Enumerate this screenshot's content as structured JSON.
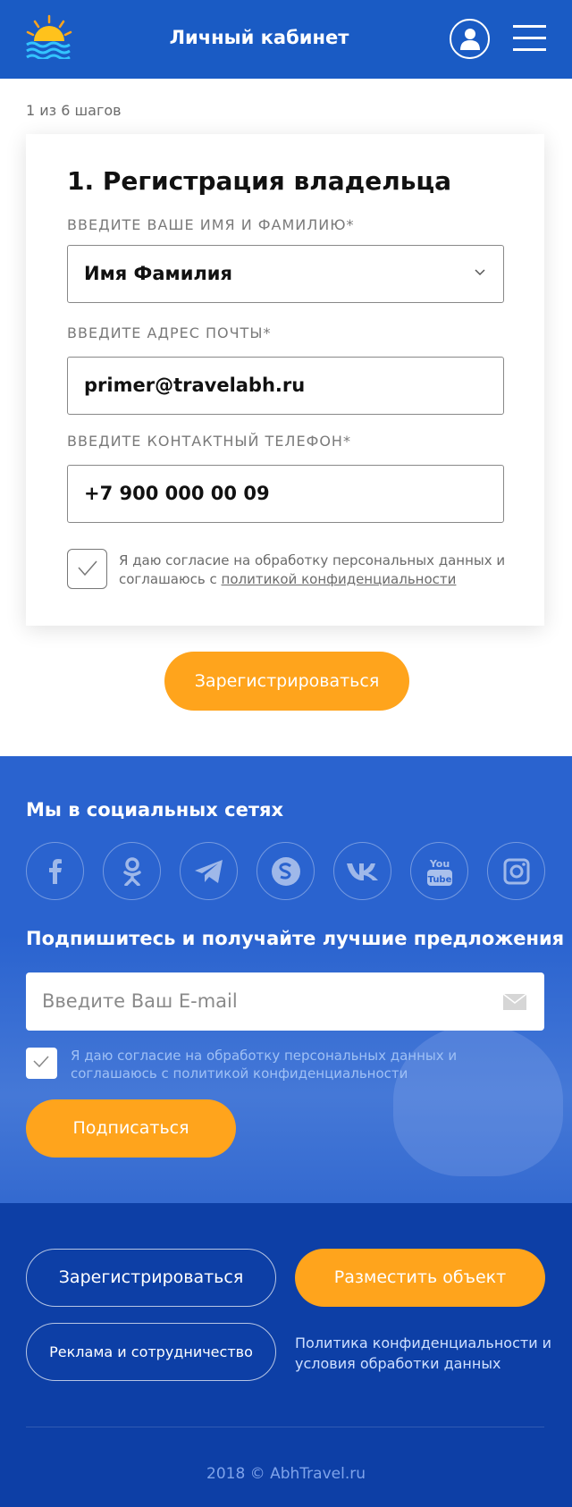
{
  "header": {
    "title": "Личный кабинет"
  },
  "step": "1 из 6 шагов",
  "form": {
    "title": "1. Регистрация владельца",
    "name_label": "ВВЕДИТЕ ВАШЕ ИМЯ И ФАМИЛИЮ*",
    "name_value": "Имя Фамилия",
    "email_label": "ВВЕДИТЕ АДРЕС ПОЧТЫ*",
    "email_value": "primer@travelabh.ru",
    "phone_label": "ВВЕДИТЕ КОНТАКТНЫЙ ТЕЛЕФОН*",
    "phone_value": "+7 900 000 00 09",
    "consent_text": "Я даю согласие на обработку персональных данных и соглашаюсь с",
    "consent_link": "политикой конфиденциальности",
    "consent_checked": true,
    "submit_label": "Зарегистрироваться"
  },
  "social": {
    "title": "Мы в социальных сетях",
    "icons": [
      "facebook-icon",
      "odnoklassniki-icon",
      "telegram-icon",
      "skype-icon",
      "vk-icon",
      "youtube-icon",
      "instagram-icon"
    ]
  },
  "subscribe": {
    "title": "Подпишитесь и получайте лучшие предложения",
    "placeholder": "Введите Ваш E-mail",
    "consent_text": "Я даю согласие на обработку персональных данных и соглашаюсь с политикой конфиденциальности",
    "consent_checked": true,
    "button_label": "Подписаться"
  },
  "footer": {
    "register_label": "Зарегистрироваться",
    "place_label": "Разместить объект",
    "ads_label": "Реклама и сотрудничество",
    "policy_text": "Политика конфиденциальности и условия обработки данных",
    "copyright": "2018 © AbhTravel.ru"
  },
  "colors": {
    "primary": "#1a5bc4",
    "accent": "#ffa41c",
    "footer": "#0d3fa6"
  }
}
